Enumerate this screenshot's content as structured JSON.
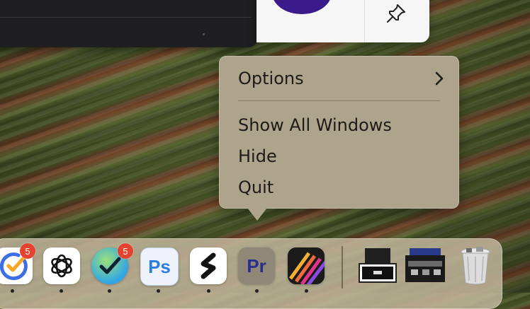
{
  "context_menu": {
    "items": [
      {
        "label": "Options",
        "has_submenu": true
      },
      {
        "label": "Show All Windows",
        "has_submenu": false
      },
      {
        "label": "Hide",
        "has_submenu": false
      },
      {
        "label": "Quit",
        "has_submenu": false
      }
    ],
    "background_color": "#aea48c"
  },
  "dock": {
    "apps": [
      {
        "name": "todo-app-icon",
        "badge": "5"
      },
      {
        "name": "chatgpt-icon"
      },
      {
        "name": "things-checkmark-icon",
        "badge": "5"
      },
      {
        "name": "photoshop-icon",
        "label": "Ps"
      },
      {
        "name": "scrivener-s-icon"
      },
      {
        "name": "premiere-pro-icon",
        "label": "Pr"
      },
      {
        "name": "gradient-stripes-app-icon"
      },
      {
        "name": "window-thumbnail-1"
      },
      {
        "name": "window-thumbnail-2"
      },
      {
        "name": "trash-icon"
      }
    ]
  },
  "colors": {
    "photoshop": "#31a8ff",
    "premiere": "#9999ff",
    "badge": "#e5432f"
  }
}
